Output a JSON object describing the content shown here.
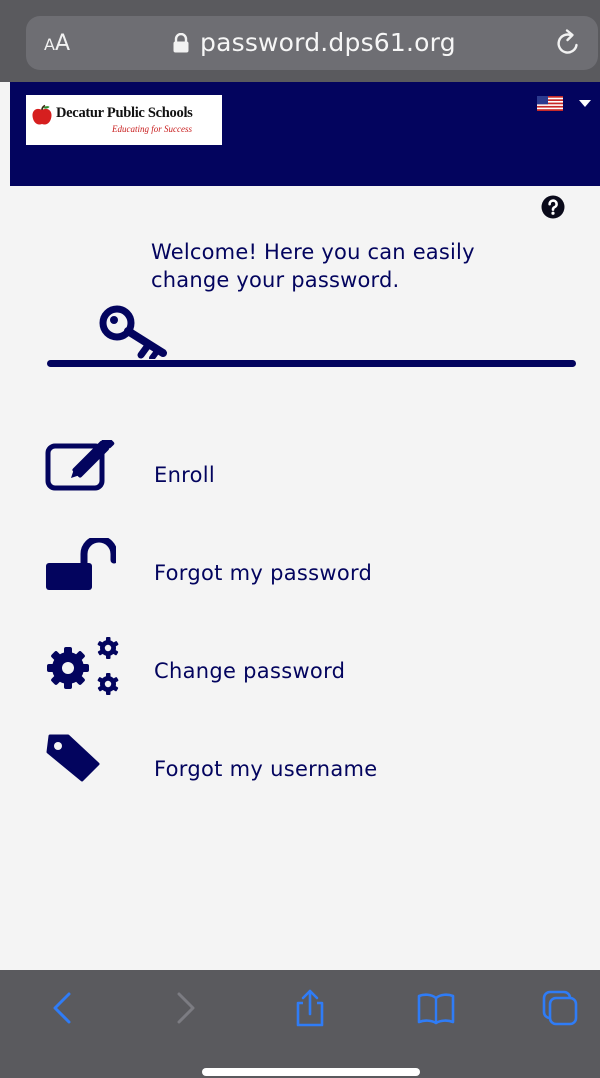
{
  "browser": {
    "aa_small": "A",
    "aa_large": "A",
    "url": "password.dps61.org",
    "icons": {
      "lock": "lock-icon",
      "reload": "reload-icon",
      "back": "chevron-left-icon",
      "forward": "chevron-right-icon",
      "share": "share-icon",
      "bookmarks": "book-icon",
      "tabs": "tabs-icon"
    },
    "colors": {
      "bar": "#5a5a5e",
      "accent": "#2f7cf6",
      "disabled": "#7c7c82"
    }
  },
  "header": {
    "logo_title": "Decatur Public Schools",
    "logo_tagline": "Educating for Success",
    "language_icon": "us-flag-icon",
    "colors": {
      "background": "#03045e",
      "tagline": "#c81c1c"
    }
  },
  "main": {
    "help_icon": "question-circle-icon",
    "welcome": "Welcome! Here you can easily change your password.",
    "hero_icon": "key-icon",
    "text_color": "#03045e",
    "menu": [
      {
        "label": "Enroll",
        "icon": "edit-icon"
      },
      {
        "label": "Forgot my password",
        "icon": "unlock-icon"
      },
      {
        "label": "Change password",
        "icon": "gears-icon"
      },
      {
        "label": "Forgot my username",
        "icon": "tag-icon"
      }
    ]
  }
}
